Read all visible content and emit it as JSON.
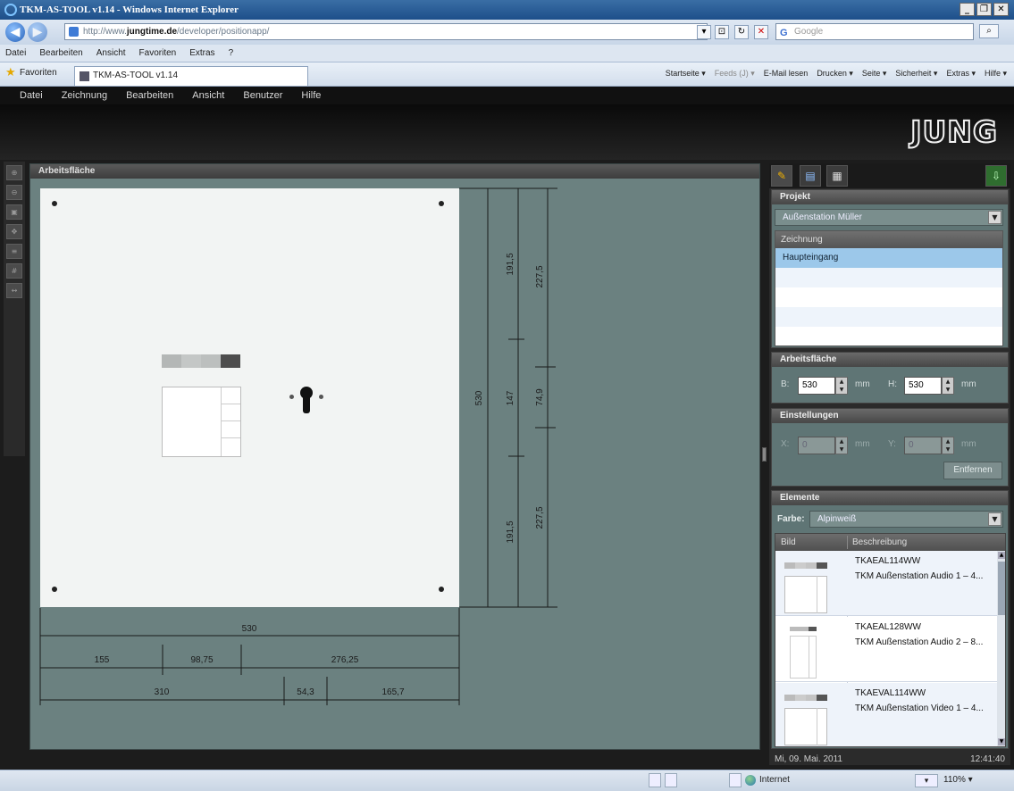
{
  "browser": {
    "window_title": "TKM-AS-TOOL v1.14 - Windows Internet Explorer",
    "url_prefix": "http://www.",
    "url_domain": "jungtime.de",
    "url_path": "/developer/positionapp/",
    "search_placeholder": "Google",
    "menu": [
      "Datei",
      "Bearbeiten",
      "Ansicht",
      "Favoriten",
      "Extras",
      "?"
    ],
    "favorites_label": "Favoriten",
    "tab_title": "TKM-AS-TOOL v1.14",
    "commands": [
      "Startseite ▾",
      "Feeds (J) ▾",
      "E-Mail lesen",
      "Drucken ▾",
      "Seite ▾",
      "Sicherheit ▾",
      "Extras ▾",
      "Hilfe ▾"
    ],
    "status_zone": "Internet",
    "status_zoom": "110% ▾"
  },
  "app": {
    "menu": [
      "Datei",
      "Zeichnung",
      "Bearbeiten",
      "Ansicht",
      "Benutzer",
      "Hilfe"
    ],
    "logo": "JUNG",
    "workspace_title": "Arbeitsfläche",
    "dimensions": {
      "height_total": "530",
      "height_parts_inner": [
        "191,5",
        "147",
        "191,5"
      ],
      "height_parts_outer": [
        "227,5",
        "74,9",
        "227,5"
      ],
      "width_total": "530",
      "width_row1": [
        "155",
        "98,75",
        "276,25"
      ],
      "width_row2": [
        "310",
        "54,3",
        "165,7"
      ]
    },
    "panel": {
      "projekt_title": "Projekt",
      "projekt_value": "Außenstation Müller",
      "zeichnung_header": "Zeichnung",
      "zeichnung_items": [
        "Haupteingang"
      ],
      "arbeitsflaeche_title": "Arbeitsfläche",
      "b_label": "B:",
      "b_value": "530",
      "h_label": "H:",
      "h_value": "530",
      "unit": "mm",
      "einstellungen_title": "Einstellungen",
      "x_label": "X:",
      "x_value": "0",
      "y_label": "Y:",
      "y_value": "0",
      "entfernen_label": "Entfernen",
      "elemente_title": "Elemente",
      "farbe_label": "Farbe:",
      "farbe_value": "Alpinweiß",
      "col_bild": "Bild",
      "col_beschreibung": "Beschreibung",
      "elements": [
        {
          "code": "TKAEAL114WW",
          "desc": "TKM Außenstation Audio 1 – 4..."
        },
        {
          "code": "TKAEAL128WW",
          "desc": "TKM Außenstation Audio 2 – 8..."
        },
        {
          "code": "TKAEVAL114WW",
          "desc": "TKM Außenstation Video 1 – 4..."
        }
      ]
    },
    "status_date": "Mi, 09. Mai. 2011",
    "status_time": "12:41:40"
  }
}
